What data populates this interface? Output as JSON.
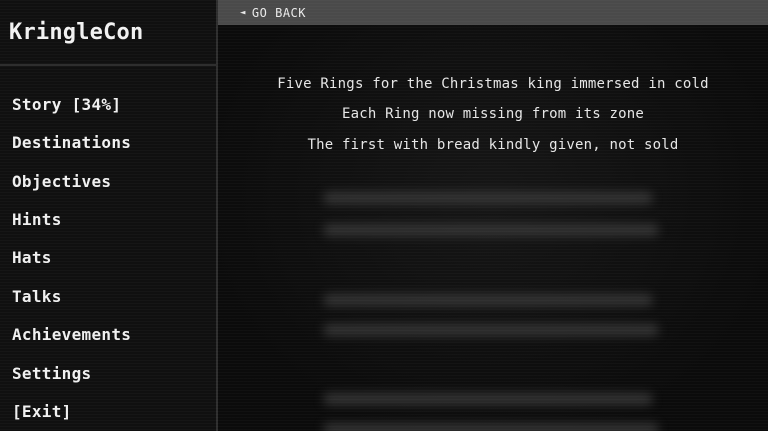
{
  "app": {
    "title": "KringleCon"
  },
  "sidebar": {
    "items": [
      {
        "label": "Story [34%]"
      },
      {
        "label": "Destinations"
      },
      {
        "label": "Objectives"
      },
      {
        "label": "Hints"
      },
      {
        "label": "Hats"
      },
      {
        "label": "Talks"
      },
      {
        "label": "Achievements"
      },
      {
        "label": "Settings"
      },
      {
        "label": "[Exit]"
      }
    ]
  },
  "topbar": {
    "back_icon": "triangle-left-icon",
    "back_label": "GO BACK"
  },
  "story": {
    "lines": [
      "Five Rings for the Christmas king immersed in cold",
      "Each Ring now missing from its zone",
      "The first with bread kindly given, not sold"
    ]
  }
}
